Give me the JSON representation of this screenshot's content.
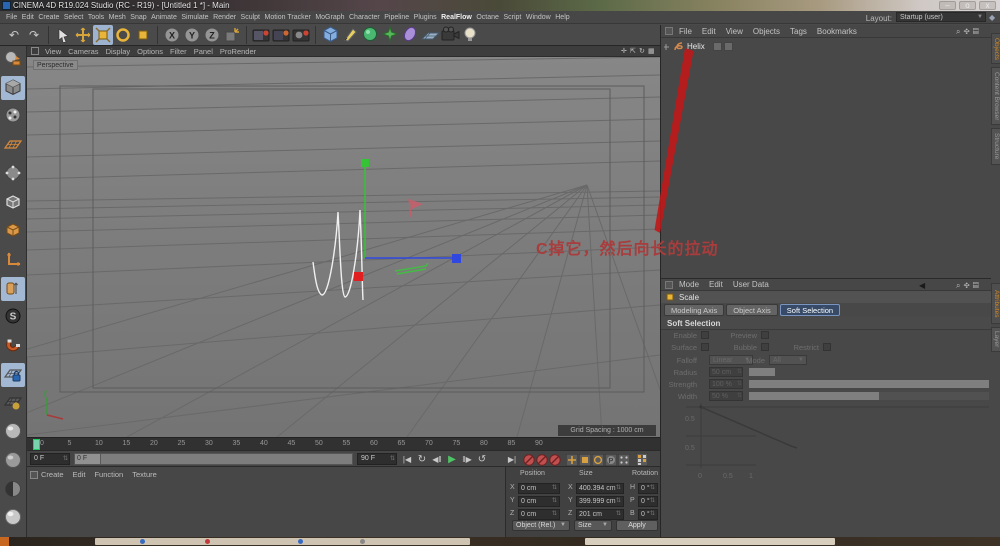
{
  "title_bar": {
    "title": "CINEMA 4D R19.024 Studio (RC - R19) - [Untitled 1 *] - Main",
    "minimize": "–",
    "maximize": "o",
    "close": "x"
  },
  "menu_bar": {
    "items": [
      "File",
      "Edit",
      "Create",
      "Select",
      "Tools",
      "Mesh",
      "Snap",
      "Animate",
      "Simulate",
      "Render",
      "Sculpt",
      "Motion Tracker",
      "MoGraph",
      "Character",
      "Pipeline",
      "Plugins",
      "RealFlow",
      "Octane",
      "Script",
      "Window",
      "Help"
    ],
    "highlight_item": "RealFlow",
    "layout_label": "Layout:",
    "layout_value": "Startup (user)"
  },
  "toolbar_icons": [
    "undo",
    "redo",
    "sep",
    "live-selection",
    "move",
    "scale-active",
    "rotate",
    "last-tool",
    "sep",
    "axis-x",
    "axis-y",
    "axis-z",
    "coord-system",
    "sep",
    "render-view",
    "render-region",
    "render-settings",
    "sep",
    "cube-primitive",
    "pen-spline",
    "mograph-sphere",
    "simulate-star",
    "spline-ellipse",
    "floor",
    "camera",
    "light"
  ],
  "left_toolbar_icons": [
    "convert",
    "model-active",
    "texture",
    "workplane",
    "points",
    "edges",
    "polygons",
    "axis",
    "object-axis-active",
    "snap",
    "magnet",
    "workplane-lock-active",
    "workplane-grid",
    "sphere1",
    "sphere2",
    "sphere3",
    "sphere4"
  ],
  "viewport": {
    "menu": [
      "View",
      "Cameras",
      "Display",
      "Options",
      "Filter",
      "Panel",
      "ProRender"
    ],
    "camera_label": "Perspective",
    "grid_spacing": "Grid Spacing : 1000 cm",
    "annotation": "C掉它，然后向长的拉动",
    "view_icons": "✛ ↻ ⤢ ▦"
  },
  "object_manager": {
    "menu": [
      "File",
      "Edit",
      "View",
      "Objects",
      "Tags",
      "Bookmarks"
    ],
    "right_icons": "🔍 ⬡ ▤",
    "objects": [
      {
        "name": "Helix"
      }
    ]
  },
  "vertical_tabs": {
    "top": [
      {
        "label": "Objects",
        "active": true
      },
      {
        "label": "Content Browser",
        "active": false
      },
      {
        "label": "Structure",
        "active": false
      }
    ],
    "bottom": [
      {
        "label": "Attributes",
        "active": true
      },
      {
        "label": "Layer",
        "active": false
      }
    ]
  },
  "attribute_manager": {
    "menu": [
      "Mode",
      "Edit",
      "User Data"
    ],
    "back_arrow": "◀",
    "right_icons": "🔍 ⬡ ▤",
    "tool": "Scale",
    "tabs": [
      "Modeling Axis",
      "Object Axis",
      "Soft Selection"
    ],
    "active_tab": "Soft Selection",
    "section": "Soft Selection",
    "params": {
      "enable_label": "Enable",
      "preview_label": "Preview",
      "surface_label": "Surface",
      "bubble_label": "Bubble",
      "restrict_label": "Restrict",
      "falloff_label": "Falloff",
      "falloff_value": "Linear",
      "mode_label": "Mode",
      "mode_value": "All",
      "radius_label": "Radius",
      "radius_value": "50 cm",
      "strength_label": "Strength",
      "strength_value": "100 %",
      "width_label": "Width",
      "width_value": "50 %"
    },
    "graph": {
      "y_labels": [
        "0.5",
        "0.5"
      ],
      "x_labels": [
        "0",
        "0.5",
        "1"
      ]
    }
  },
  "timeline": {
    "ticks": [
      "0",
      "5",
      "10",
      "15",
      "20",
      "25",
      "30",
      "35",
      "40",
      "45",
      "50",
      "55",
      "60",
      "65",
      "70",
      "75",
      "80",
      "85",
      "90"
    ],
    "current_frame": "0 F",
    "slider_label": "0 F",
    "end_frame": "90 F",
    "transport_icons": [
      "goto-start",
      "play-backwards",
      "prev-frame",
      "play-forward",
      "next-frame",
      "loop",
      "goto-end"
    ],
    "record_icons": [
      "record",
      "autokey",
      "keyframe-selection"
    ],
    "toggle_icons": [
      "record-position",
      "record-scale",
      "record-rotation",
      "record-parameter",
      "record-pla"
    ]
  },
  "materials_panel": {
    "menu": [
      "Create",
      "Edit",
      "Function",
      "Texture"
    ]
  },
  "coordinates": {
    "col_headers": [
      "Position",
      "Size",
      "Rotation"
    ],
    "rows": [
      {
        "pl": "X",
        "pv": "0 cm",
        "sl": "X",
        "sv": "400.394 cm",
        "rl": "H",
        "rv": "0 °"
      },
      {
        "pl": "Y",
        "pv": "0 cm",
        "sl": "Y",
        "sv": "399.999 cm",
        "rl": "P",
        "rv": "0 °"
      },
      {
        "pl": "Z",
        "pv": "0 cm",
        "sl": "Z",
        "sv": "201 cm",
        "rl": "B",
        "rv": "0 °"
      }
    ],
    "mode_dropdown": "Object (Rel.)",
    "size_dropdown": "Size",
    "apply_label": "Apply"
  }
}
